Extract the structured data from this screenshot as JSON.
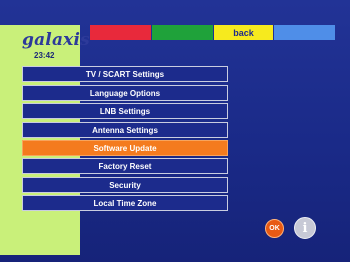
{
  "app": {
    "brand": "galaxis",
    "time": "23:42"
  },
  "color_keys": {
    "red": "#e8293b",
    "green": "#1fa23a",
    "yellow_label": "back",
    "blue": "#4f8ee8"
  },
  "menu": {
    "selected_index": 4,
    "items": [
      {
        "label": "TV / SCART Settings"
      },
      {
        "label": "Language Options"
      },
      {
        "label": "LNB Settings"
      },
      {
        "label": "Antenna Settings"
      },
      {
        "label": "Software Update"
      },
      {
        "label": "Factory Reset"
      },
      {
        "label": "Security"
      },
      {
        "label": "Local Time Zone"
      }
    ]
  },
  "buttons": {
    "ok_label": "OK",
    "info_icon": "info-icon"
  },
  "colors": {
    "background": "#1a2a88",
    "sidebar": "#c9f07a",
    "highlight": "#f47b1e"
  }
}
